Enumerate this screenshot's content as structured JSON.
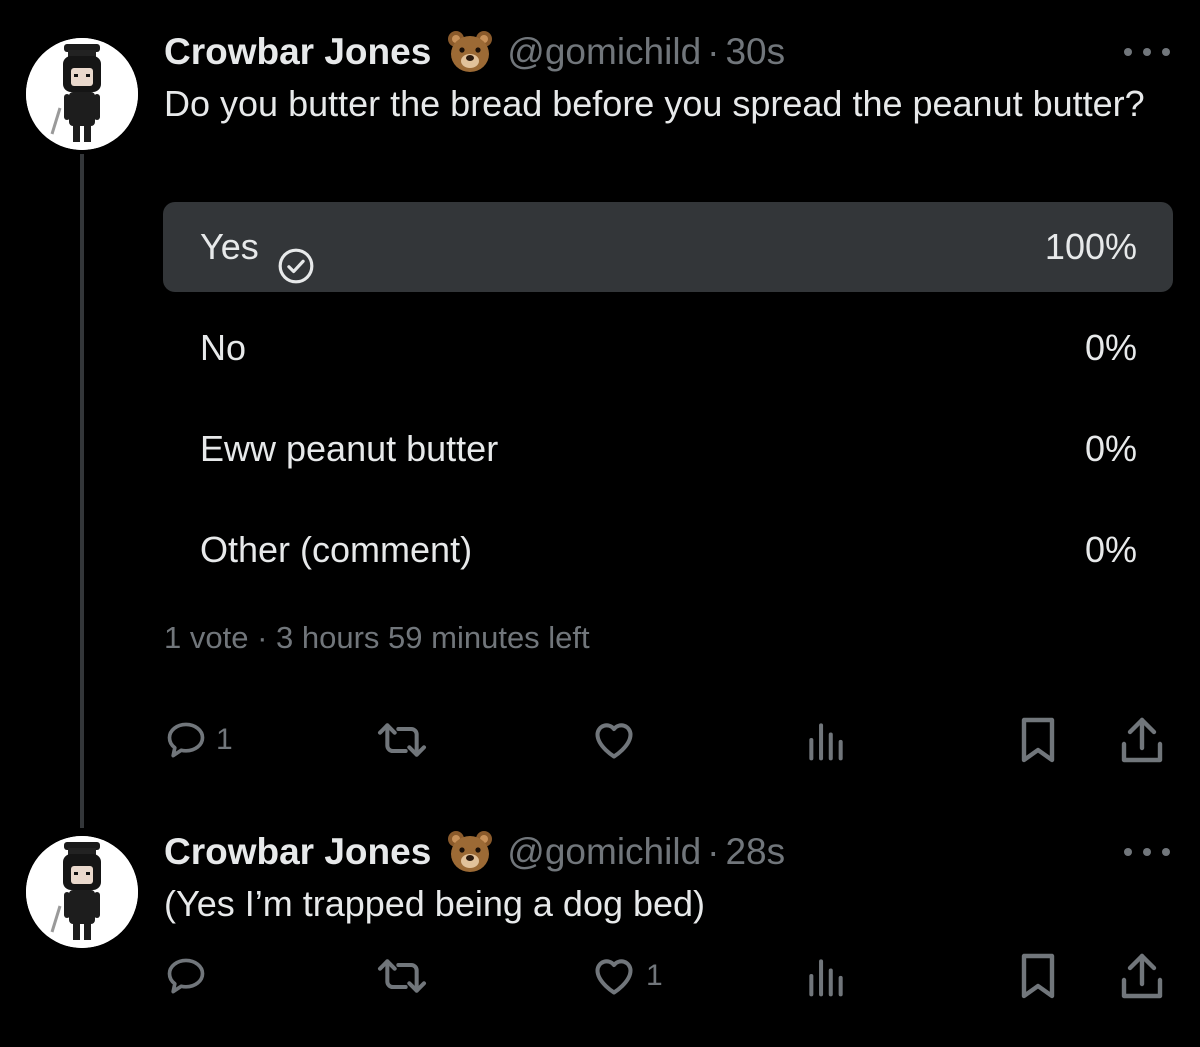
{
  "tweets": [
    {
      "name": "Crowbar Jones",
      "name_emoji": "bear-face-icon",
      "handle": "@gomichild",
      "separator": "·",
      "time": "30s",
      "text": "Do you butter the bread before you spread the peanut butter?",
      "poll": {
        "options": [
          {
            "label": "Yes",
            "percent": "100%",
            "fill_fraction": 1.0,
            "voted": true
          },
          {
            "label": "No",
            "percent": "0%",
            "fill_fraction": 0.0,
            "voted": false
          },
          {
            "label": "Eww peanut butter",
            "percent": "0%",
            "fill_fraction": 0.0,
            "voted": false
          },
          {
            "label": "Other (comment)",
            "percent": "0%",
            "fill_fraction": 0.0,
            "voted": false
          }
        ],
        "votes": "1 vote",
        "separator": "·",
        "time_left": "3 hours 59 minutes left"
      },
      "actions": {
        "reply_count": "1",
        "retweet_count": "",
        "like_count": "",
        "views_count": ""
      }
    },
    {
      "name": "Crowbar Jones",
      "name_emoji": "bear-face-icon",
      "handle": "@gomichild",
      "separator": "·",
      "time": "28s",
      "text": "(Yes I’m trapped being a dog bed)",
      "actions": {
        "reply_count": "",
        "retweet_count": "",
        "like_count": "1",
        "views_count": ""
      }
    }
  ],
  "colors": {
    "background": "#000000",
    "text_primary": "#e7e9ea",
    "text_secondary": "#71767b",
    "poll_fill": "#333639",
    "thread_line": "#333639"
  }
}
